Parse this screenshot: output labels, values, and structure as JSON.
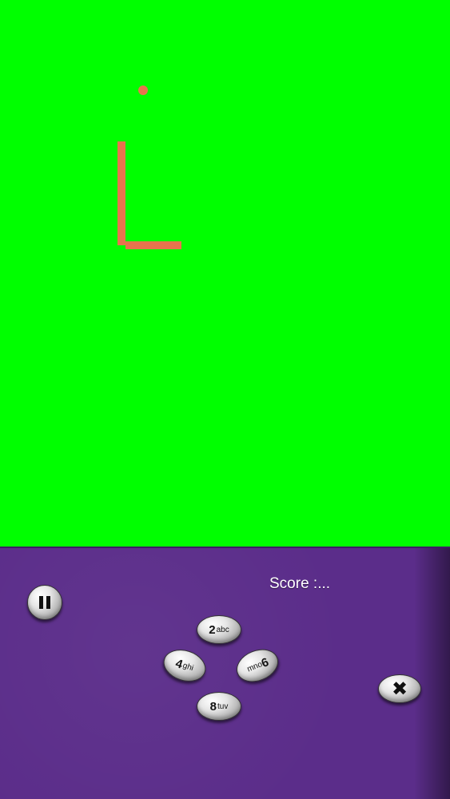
{
  "game": {
    "snake_color": "#e8744d",
    "board_color": "#00ff00",
    "panel_color": "#5b2d8a"
  },
  "score": {
    "label": "Score :..."
  },
  "controls": {
    "pause_icon": "pause-icon",
    "up_key": {
      "number": "2",
      "letters": "abc"
    },
    "left_key": {
      "number": "4",
      "letters": "ghi"
    },
    "right_key": {
      "number": "6",
      "letters": "mno"
    },
    "down_key": {
      "number": "8",
      "letters": "tuv"
    },
    "close_icon": "close-icon",
    "close_symbol": "✖"
  }
}
